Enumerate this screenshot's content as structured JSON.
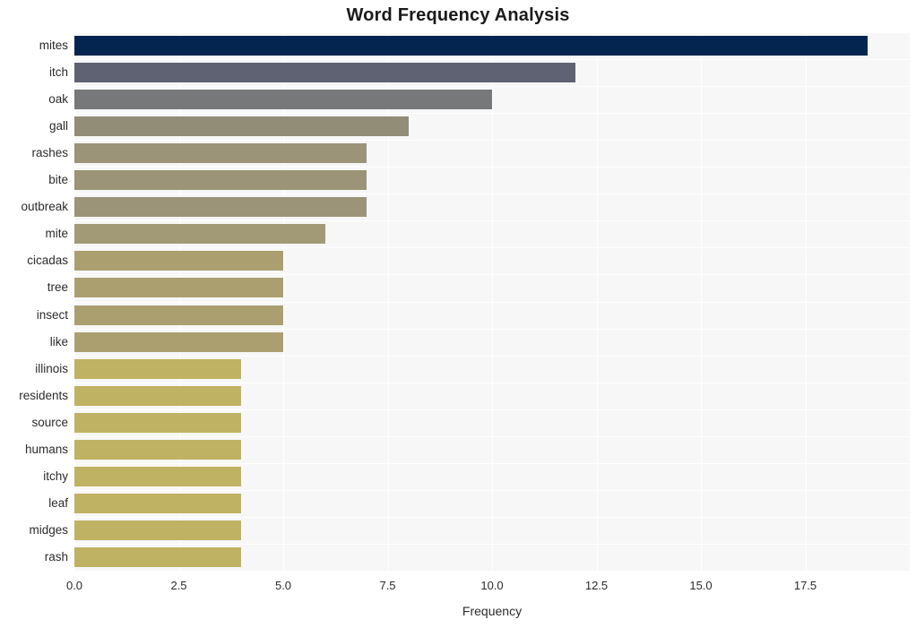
{
  "chart_data": {
    "type": "bar",
    "orientation": "horizontal",
    "title": "Word Frequency Analysis",
    "xlabel": "Frequency",
    "ylabel": "",
    "categories": [
      "mites",
      "itch",
      "oak",
      "gall",
      "rashes",
      "bite",
      "outbreak",
      "mite",
      "cicadas",
      "tree",
      "insect",
      "like",
      "illinois",
      "residents",
      "source",
      "humans",
      "itchy",
      "leaf",
      "midges",
      "rash"
    ],
    "values": [
      19,
      12,
      10,
      8,
      7,
      7,
      7,
      6,
      5,
      5,
      5,
      5,
      4,
      4,
      4,
      4,
      4,
      4,
      4,
      4
    ],
    "xlim": [
      0,
      20
    ],
    "xticks": [
      "0.0",
      "2.5",
      "5.0",
      "7.5",
      "10.0",
      "12.5",
      "15.0",
      "17.5"
    ],
    "xtick_values": [
      0,
      2.5,
      5,
      7.5,
      10,
      12.5,
      15,
      17.5
    ],
    "grid": true,
    "legend": false,
    "bar_colors": [
      "#03254f",
      "#5e6272",
      "#77787a",
      "#918d77",
      "#9b9478",
      "#9b9478",
      "#9b9478",
      "#a29a77",
      "#ab9f70",
      "#ab9f70",
      "#ab9f70",
      "#ab9f70",
      "#c0b263",
      "#c0b263",
      "#c0b263",
      "#c0b263",
      "#c0b263",
      "#c0b263",
      "#c0b263",
      "#c0b263"
    ],
    "plot_background": "#f7f7f7",
    "figure_background": "#ffffff",
    "gridline_color": "#ffffff",
    "text_color": "#2b2b2b"
  }
}
